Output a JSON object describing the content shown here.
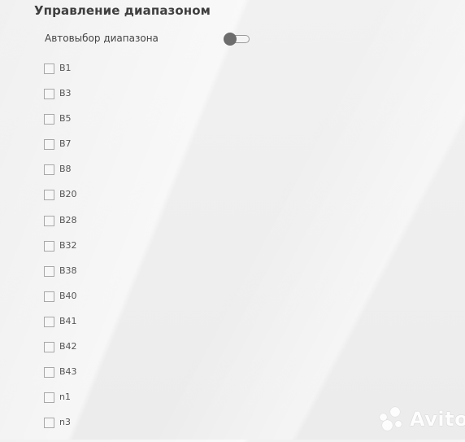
{
  "section": {
    "title": "Управление диапазоном",
    "auto_select": {
      "label": "Автовыбор диапазона",
      "enabled": false
    },
    "bands": [
      {
        "label": "B1",
        "checked": false
      },
      {
        "label": "B3",
        "checked": false
      },
      {
        "label": "B5",
        "checked": false
      },
      {
        "label": "B7",
        "checked": false
      },
      {
        "label": "B8",
        "checked": false
      },
      {
        "label": "B20",
        "checked": false
      },
      {
        "label": "B28",
        "checked": false
      },
      {
        "label": "B32",
        "checked": false
      },
      {
        "label": "B38",
        "checked": false
      },
      {
        "label": "B40",
        "checked": false
      },
      {
        "label": "B41",
        "checked": false
      },
      {
        "label": "B42",
        "checked": false
      },
      {
        "label": "B43",
        "checked": false
      },
      {
        "label": "n1",
        "checked": false
      },
      {
        "label": "n3",
        "checked": false
      }
    ]
  },
  "watermark": {
    "text": "Avito"
  },
  "colors": {
    "background": "#ececec",
    "toggle_knob": "#6d6d6d",
    "checkbox_border": "#a8a8a8",
    "title_text": "#3f3f3f"
  }
}
